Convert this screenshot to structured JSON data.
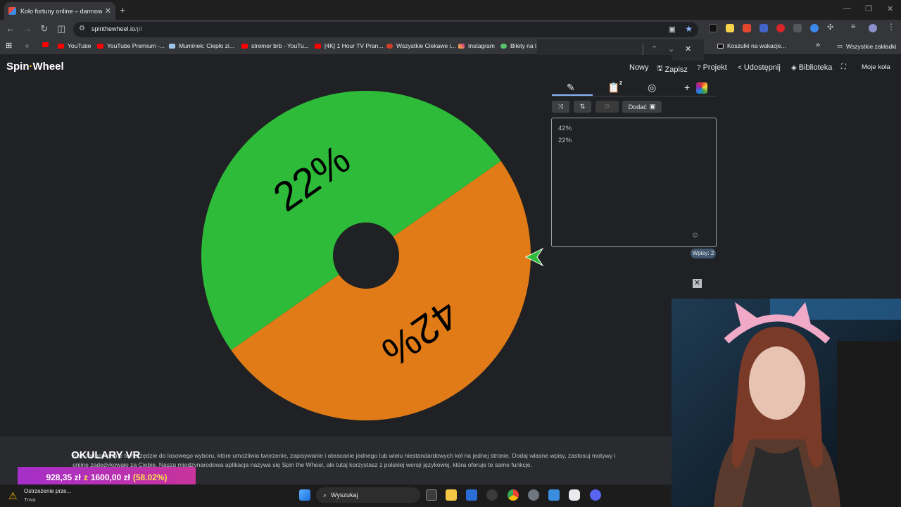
{
  "browser": {
    "tab_title": "Koło fortuny online – darmowe",
    "url_host": "spinthewheel.io",
    "url_path": "/pl"
  },
  "bookmarks": [
    "YouTube",
    "YouTube Premium -...",
    "Muminek: Ciepło zi...",
    "stremer brb - YouTu...",
    "[4K] 1 Hour TV Pran...",
    "Wszystkie Ciekawe i...",
    "Instagram",
    "Bilety na l",
    "Koszulki na wakacje...",
    "Wszystkie zakładki"
  ],
  "site": {
    "logo_a": "Spin",
    "logo_b": "Wheel",
    "nav": {
      "new": "Nowy",
      "save": "Zapisz",
      "project": "Projekt",
      "share": "Udostępnij",
      "library": "Biblioteka",
      "my_wheels": "Moje koła"
    }
  },
  "wheel": {
    "segments": [
      {
        "label": "42%",
        "color": "#e07b17"
      },
      {
        "label": "22%",
        "color": "#2fbb3a"
      }
    ],
    "pointer_color": "#2fbb3a"
  },
  "editor": {
    "badge": "2",
    "add_label": "Dodać",
    "entries": [
      "42%",
      "22%"
    ],
    "count_label": "Wpisy: 2"
  },
  "footer": {
    "ad_title": "OKULARY VR",
    "description_line1": "Koło fortuny online to narzędzie do losowego wyboru, które umożliwia tworzenie, zapisywanie i obracanie jednego lub wielu niestandardowych kół na jednej stronie. Dodaj własne wpisy, zastosuj motywy i",
    "description_line2": "online zadedykowało za Ciebie. Nasza międzynarodowa aplikacja nazywa się Spin the Wheel, ale tutaj korzystasz z polskiej wersji językowej, która oferuje te same funkcje."
  },
  "donation": {
    "current": "928,35 zł",
    "sep": "z",
    "goal": "1600,00 zł",
    "percent": "(58.02%)"
  },
  "taskbar": {
    "warning_title": "Ostrzeżenie prze...",
    "warning_sub": "Trwa",
    "search_placeholder": "Wyszukaj"
  }
}
